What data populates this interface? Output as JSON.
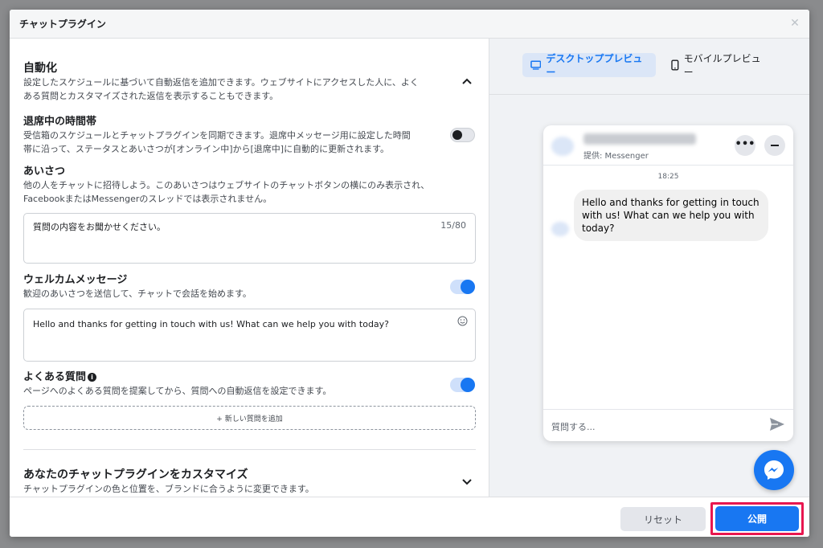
{
  "dialog": {
    "title": "チャットプラグイン",
    "close_icon": "close-icon"
  },
  "automation": {
    "title": "自動化",
    "desc_line1": "設定したスケジュールに基づいて自動返信を追加できます。ウェブサイトにアクセスした人に、よく",
    "desc_line2": "ある質問とカスタマイズされた返信を表示することもできます。",
    "away": {
      "title": "退席中の時間帯",
      "desc_line1": "受信箱のスケジュールとチャットプラグインを同期できます。退席中メッセージ用に設定した時間",
      "desc_line2": "帯に沿って、ステータスとあいさつが[オンライン中]から[退席中]に自動的に更新されます。",
      "enabled": false
    },
    "greeting": {
      "title": "あいさつ",
      "desc_line1": "他の人をチャットに招待しよう。このあいさつはウェブサイトのチャットボタンの横にのみ表示され、",
      "desc_line2": "FacebookまたはMessengerのスレッドでは表示されません。",
      "value": "質問の内容をお聞かせください。",
      "count": "15/80"
    },
    "welcome": {
      "title": "ウェルカムメッセージ",
      "desc": "歓迎のあいさつを送信して、チャットで会話を始めます。",
      "enabled": true,
      "value": "Hello and thanks for getting in touch with us! What can we help you with today?"
    },
    "faq": {
      "title": "よくある質問",
      "info_glyph": "i",
      "desc": "ページへのよくある質問を提案してから、質問への自動返信を設定できます。",
      "enabled": true,
      "add_label": "+ 新しい質問を追加"
    }
  },
  "customize": {
    "title": "あなたのチャットプラグインをカスタマイズ",
    "desc": "チャットプラグインの色と位置を、ブランドに合うように変更できます。"
  },
  "preview": {
    "tab_desktop": "デスクトッププレビュー",
    "tab_mobile": "モバイルプレビュー",
    "chat": {
      "provided_by": "提供: Messenger",
      "more_glyph": "•••",
      "time": "18:25",
      "message": "Hello and thanks for getting in touch with us! What can we help you with today?",
      "input_placeholder": "質問する..."
    }
  },
  "footer": {
    "reset_label": "リセット",
    "publish_label": "公開"
  },
  "colors": {
    "accent": "#1877f2",
    "highlight": "#e8174f"
  }
}
